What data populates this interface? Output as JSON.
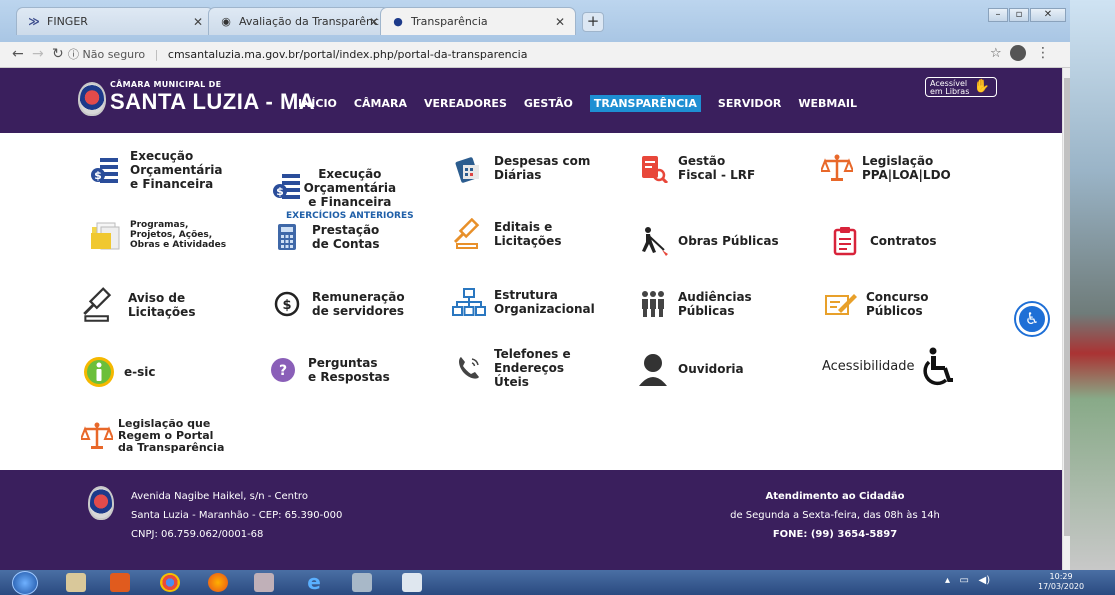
{
  "browser": {
    "tabs": [
      {
        "label": "FINGER",
        "active": false
      },
      {
        "label": "Avaliação da Transparência dos",
        "active": false
      },
      {
        "label": "Transparência",
        "active": true
      }
    ],
    "url_security": "Não seguro",
    "url_text": "cmsantaluzia.ma.gov.br/portal/index.php/portal-da-transparencia"
  },
  "site": {
    "logo_small": "CÂMARA MUNICIPAL DE",
    "logo_big": "SANTA LUZIA - MA",
    "nav": [
      "INÍCIO",
      "CÂMARA",
      "VEREADORES",
      "GESTÃO",
      "TRANSPARÊNCIA",
      "SERVIDOR",
      "WEBMAIL"
    ],
    "nav_active": "TRANSPARÊNCIA",
    "libras_line1": "Acessível",
    "libras_line2": "em Libras",
    "items": [
      {
        "l1": "Execução",
        "l2": "Orçamentária",
        "l3": "e Financeira"
      },
      {
        "l1": "Execução",
        "l2": "Orçamentária",
        "l3": "e Financeira",
        "sub": "EXERCÍCIOS ANTERIORES"
      },
      {
        "l1": "Despesas com",
        "l2": "Diárias"
      },
      {
        "l1": "Gestão",
        "l2": "Fiscal - LRF"
      },
      {
        "l1": "Legislação",
        "l2": "PPA|LOA|LDO"
      },
      {
        "l1": "Programas,",
        "l2": "Projetos, Ações,",
        "l3": "Obras e Atividades"
      },
      {
        "l1": "Prestação",
        "l2": "de Contas"
      },
      {
        "l1": "Editais e",
        "l2": "Licitações"
      },
      {
        "l1": "Obras Públicas"
      },
      {
        "l1": "Contratos"
      },
      {
        "l1": "Aviso de",
        "l2": "Licitações"
      },
      {
        "l1": "Remuneração",
        "l2": "de servidores"
      },
      {
        "l1": "Estrutura",
        "l2": "Organizacional"
      },
      {
        "l1": "Audiências",
        "l2": "Públicas"
      },
      {
        "l1": "Concurso",
        "l2": "Públicos"
      },
      {
        "l1": "e-sic"
      },
      {
        "l1": "Perguntas",
        "l2": "e Respostas"
      },
      {
        "l1": "Telefones e",
        "l2": "Endereços",
        "l3": "Úteis"
      },
      {
        "l1": "Ouvidoria"
      },
      {
        "l1": "Acessibilidade"
      },
      {
        "l1": "Legislação que",
        "l2": "Regem o Portal",
        "l3": "da Transparência"
      }
    ],
    "footer": {
      "addr1": "Avenida Nagibe Haikel, s/n - Centro",
      "addr2": "Santa Luzia - Maranhão - CEP: 65.390-000",
      "addr3": "CNPJ: 06.759.062/0001-68",
      "atend_title": "Atendimento ao Cidadão",
      "atend_hours": "de Segunda a Sexta-feira, das 08h às 14h",
      "atend_phone": "FONE: (99) 3654-5897"
    }
  },
  "taskbar": {
    "time": "10:29",
    "date": "17/03/2020"
  },
  "colors": {
    "header_bg": "#3a1f5d",
    "active_nav": "#1e8fd3"
  }
}
